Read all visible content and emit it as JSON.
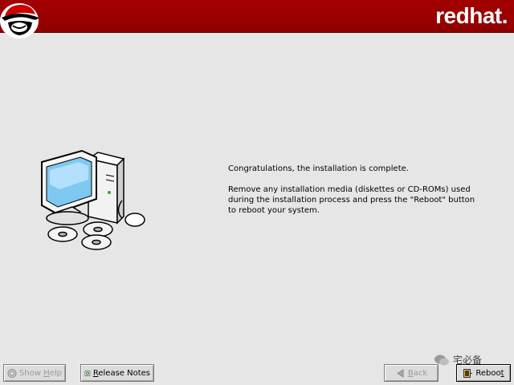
{
  "header": {
    "brand": "redhat.",
    "logo_icon": "redhat-shadowman-icon",
    "color": "#9a0000"
  },
  "message": {
    "line1": "Congratulations, the installation is complete.",
    "line2": "Remove any installation media (diskettes or CD-ROMs) used during the installation process and press the \"Reboot\" button to reboot your system."
  },
  "buttons": {
    "help": {
      "prefix": "Show ",
      "accel": "H",
      "rest": "elp",
      "icon": "help-icon",
      "enabled": false
    },
    "notes": {
      "accel": "R",
      "rest": "elease Notes",
      "icon": "release-notes-icon",
      "enabled": true
    },
    "back": {
      "accel": "B",
      "rest": "ack",
      "icon": "back-arrow-icon",
      "enabled": false
    },
    "reboot": {
      "prefix": "Reboo",
      "accel": "t",
      "icon": "reboot-icon",
      "enabled": true
    }
  },
  "illustration": "computer-with-cds-icon",
  "watermark": {
    "text": "宅必备",
    "icon": "wechat-icon"
  }
}
